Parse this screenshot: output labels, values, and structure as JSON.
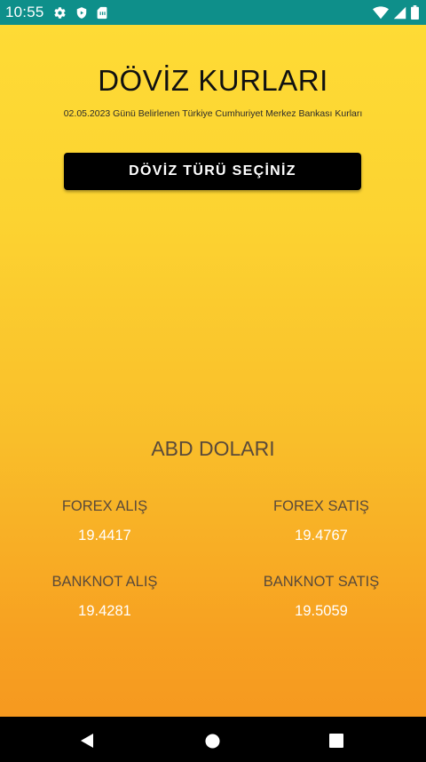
{
  "status_bar": {
    "time": "10:55",
    "icons_left": [
      "gear-icon",
      "shield-icon",
      "sim-card-icon"
    ],
    "icons_right": [
      "wifi-icon",
      "cell-signal-icon",
      "battery-icon"
    ],
    "color": "#0E8F8A"
  },
  "header": {
    "title": "DÖVİZ KURLARI",
    "subtitle": "02.05.2023 Günü Belirlenen Türkiye Cumhuriyet Merkez Bankası Kurları"
  },
  "select_button": {
    "label": "DÖVİZ TÜRÜ SEÇİNİZ"
  },
  "currency": {
    "name": "ABD DOLARI",
    "forex_buy": {
      "label": "FOREX ALIŞ",
      "value": "19.4417"
    },
    "forex_sell": {
      "label": "FOREX SATIŞ",
      "value": "19.4767"
    },
    "banknote_buy": {
      "label": "BANKNOT ALIŞ",
      "value": "19.4281"
    },
    "banknote_sell": {
      "label": "BANKNOT SATIŞ",
      "value": "19.5059"
    }
  },
  "nav_bar": {
    "icons": [
      "back-icon",
      "home-icon",
      "recents-icon"
    ]
  },
  "colors": {
    "gradient_top": "#FEDB35",
    "gradient_bottom": "#F6991F",
    "label_text": "#5a4a3a",
    "value_text": "#FFFFFF",
    "button_bg": "#000000"
  }
}
